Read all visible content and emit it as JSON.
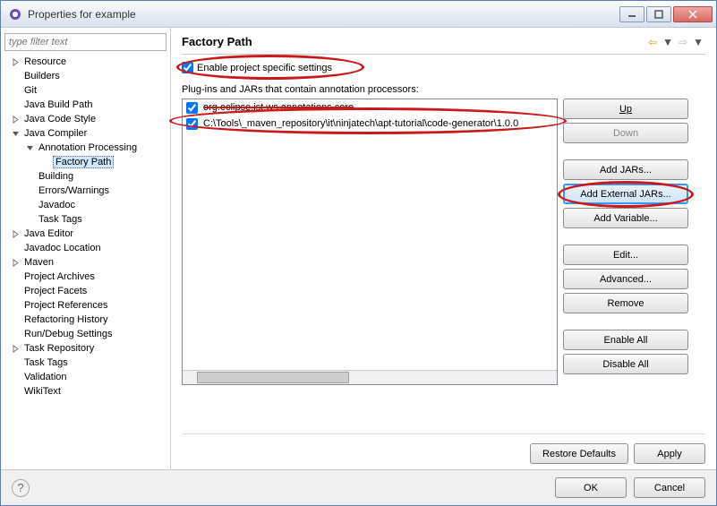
{
  "window": {
    "title": "Properties for example"
  },
  "sidebar": {
    "filter_placeholder": "type filter text",
    "items": [
      {
        "label": "Resource",
        "depth": 0,
        "expandable": true,
        "expanded": false
      },
      {
        "label": "Builders",
        "depth": 0,
        "expandable": false
      },
      {
        "label": "Git",
        "depth": 0,
        "expandable": false
      },
      {
        "label": "Java Build Path",
        "depth": 0,
        "expandable": false
      },
      {
        "label": "Java Code Style",
        "depth": 0,
        "expandable": true,
        "expanded": false
      },
      {
        "label": "Java Compiler",
        "depth": 0,
        "expandable": true,
        "expanded": true
      },
      {
        "label": "Annotation Processing",
        "depth": 1,
        "expandable": true,
        "expanded": true
      },
      {
        "label": "Factory Path",
        "depth": 2,
        "expandable": false,
        "selected": true
      },
      {
        "label": "Building",
        "depth": 1,
        "expandable": false
      },
      {
        "label": "Errors/Warnings",
        "depth": 1,
        "expandable": false
      },
      {
        "label": "Javadoc",
        "depth": 1,
        "expandable": false
      },
      {
        "label": "Task Tags",
        "depth": 1,
        "expandable": false
      },
      {
        "label": "Java Editor",
        "depth": 0,
        "expandable": true,
        "expanded": false
      },
      {
        "label": "Javadoc Location",
        "depth": 0,
        "expandable": false
      },
      {
        "label": "Maven",
        "depth": 0,
        "expandable": true,
        "expanded": false
      },
      {
        "label": "Project Archives",
        "depth": 0,
        "expandable": false
      },
      {
        "label": "Project Facets",
        "depth": 0,
        "expandable": false
      },
      {
        "label": "Project References",
        "depth": 0,
        "expandable": false
      },
      {
        "label": "Refactoring History",
        "depth": 0,
        "expandable": false
      },
      {
        "label": "Run/Debug Settings",
        "depth": 0,
        "expandable": false
      },
      {
        "label": "Task Repository",
        "depth": 0,
        "expandable": true,
        "expanded": false
      },
      {
        "label": "Task Tags",
        "depth": 0,
        "expandable": false
      },
      {
        "label": "Validation",
        "depth": 0,
        "expandable": false
      },
      {
        "label": "WikiText",
        "depth": 0,
        "expandable": false
      }
    ]
  },
  "page": {
    "title": "Factory Path",
    "enable_label": "Enable project specific settings",
    "list_label": "Plug-ins and JARs that contain annotation processors:",
    "entries": [
      {
        "label": "org.eclipse.jst.ws.annotations.core",
        "checked": true,
        "struck": true
      },
      {
        "label": "C:\\Tools\\_maven_repository\\it\\ninjatech\\apt-tutorial\\code-generator\\1.0.0",
        "checked": true
      }
    ],
    "buttons": {
      "up": "Up",
      "down": "Down",
      "add_jars": "Add JARs...",
      "add_ext_jars": "Add External JARs...",
      "add_variable": "Add Variable...",
      "edit": "Edit...",
      "advanced": "Advanced...",
      "remove": "Remove",
      "enable_all": "Enable All",
      "disable_all": "Disable All",
      "restore": "Restore Defaults",
      "apply": "Apply"
    }
  },
  "footer": {
    "ok": "OK",
    "cancel": "Cancel"
  }
}
